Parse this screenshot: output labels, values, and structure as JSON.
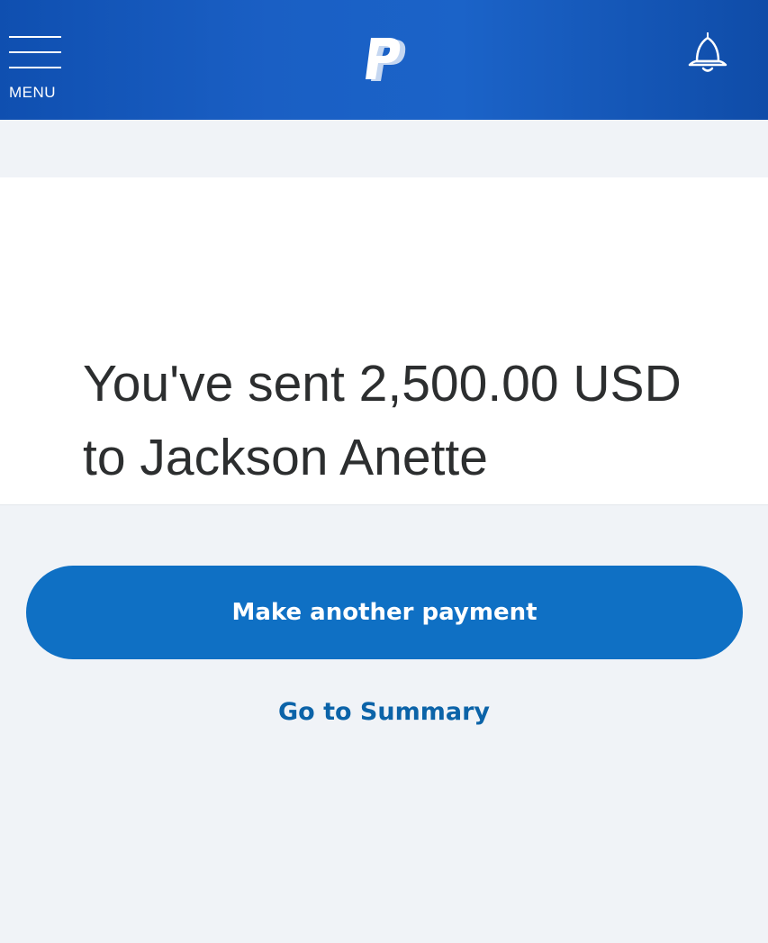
{
  "header": {
    "menu_label": "MENU",
    "logo_icon": "paypal-logo-icon",
    "notifications_icon": "bell-icon"
  },
  "confirmation": {
    "message": "You've sent 2,500.00 USD to Jackson Anette"
  },
  "actions": {
    "primary_label": "Make another payment",
    "secondary_label": "Go to Summary"
  },
  "colors": {
    "header_blue": "#1a5fc4",
    "button_blue": "#0f70c4",
    "link_blue": "#0b63a8",
    "background": "#f0f3f7",
    "card": "#ffffff",
    "text": "#2c2e2f"
  }
}
